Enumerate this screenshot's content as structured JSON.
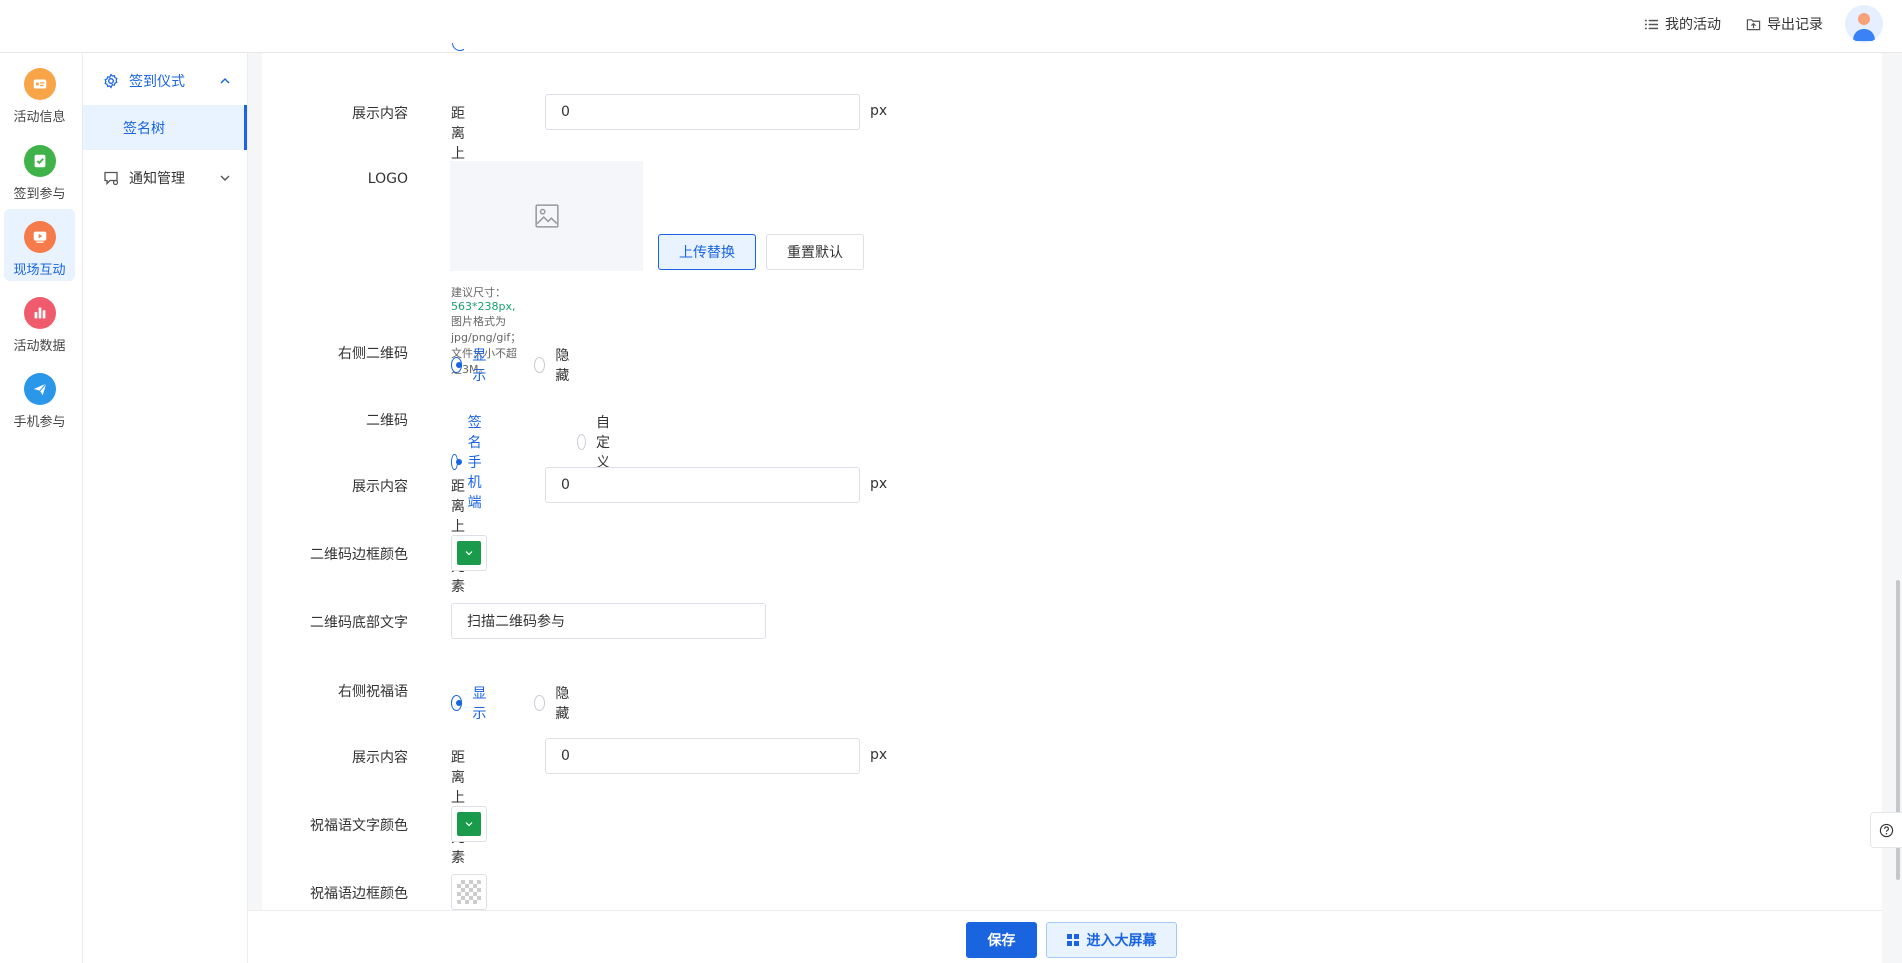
{
  "header": {
    "my_activities": "我的活动",
    "export_records": "导出记录"
  },
  "rail": [
    {
      "label": "活动信息",
      "icon": "activity-info-icon",
      "color": "#f7a548"
    },
    {
      "label": "签到参与",
      "icon": "checkin-icon",
      "color": "#3fb24a"
    },
    {
      "label": "现场互动",
      "icon": "live-interaction-icon",
      "color": "#f57b4a"
    },
    {
      "label": "活动数据",
      "icon": "activity-data-icon",
      "color": "#ef5a6c"
    },
    {
      "label": "手机参与",
      "icon": "mobile-participate-icon",
      "color": "#2b97e8"
    }
  ],
  "submenu": {
    "group1": "签到仪式",
    "item1": "签名树",
    "group2": "通知管理"
  },
  "form": {
    "row_display_content_1": {
      "label": "展示内容",
      "inline": "距离上侧元素",
      "value": "0",
      "unit": "px"
    },
    "row_logo": {
      "label": "LOGO",
      "upload": "上传替换",
      "reset": "重置默认"
    },
    "hint": {
      "prefix": "建议尺寸：",
      "size": "563*238px,",
      "suffix": "图片格式为jpg/png/gif；文件大小不超过3M。"
    },
    "row_right_qr": {
      "label": "右侧二维码",
      "opt1": "显示",
      "opt2": "隐藏"
    },
    "row_qr": {
      "label": "二维码",
      "opt1": "签名手机端",
      "opt2": "自定义"
    },
    "row_display_content_2": {
      "label": "展示内容",
      "inline": "距离上侧元素",
      "value": "0",
      "unit": "px"
    },
    "row_qr_border_color": {
      "label": "二维码边框颜色",
      "color": "#1a9a4b"
    },
    "row_qr_bottom_text": {
      "label": "二维码底部文字",
      "value": "扫描二维码参与"
    },
    "row_right_blessing": {
      "label": "右侧祝福语",
      "opt1": "显示",
      "opt2": "隐藏"
    },
    "row_display_content_3": {
      "label": "展示内容",
      "inline": "距离上侧元素",
      "value": "0",
      "unit": "px"
    },
    "row_blessing_text_color": {
      "label": "祝福语文字颜色",
      "color": "#1a9a4b"
    },
    "row_blessing_border_color": {
      "label": "祝福语边框颜色"
    }
  },
  "footer": {
    "save": "保存",
    "enter_screen": "进入大屏幕"
  },
  "colors": {
    "accent": "#1a64e0"
  }
}
